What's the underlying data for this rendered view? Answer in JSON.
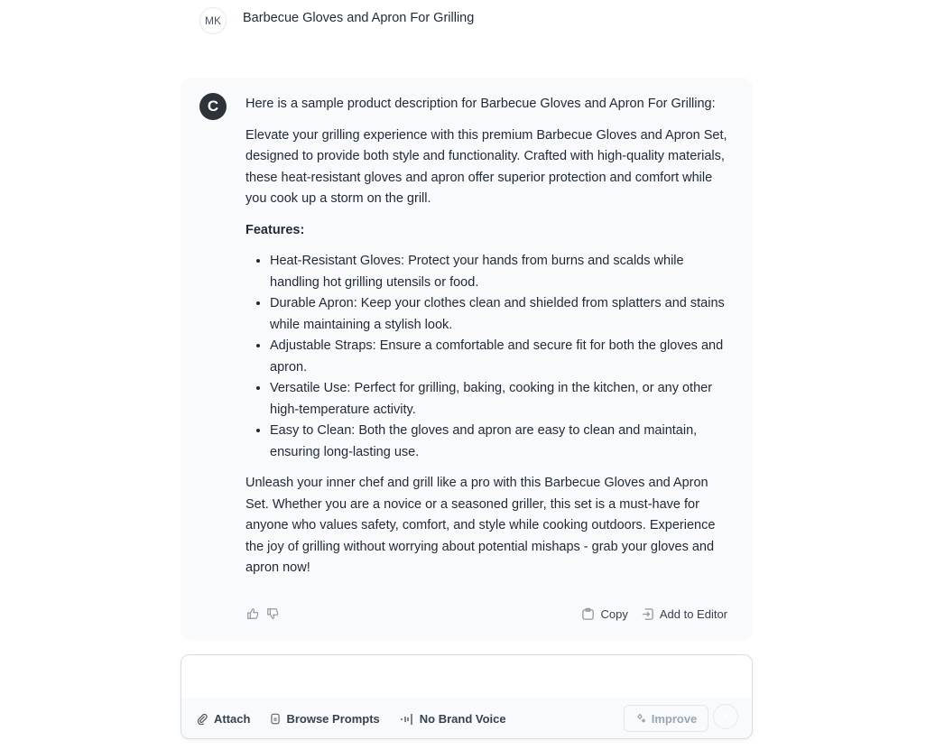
{
  "user_message": {
    "avatar_initials": "MK",
    "text": "Barbecue Gloves and Apron For Grilling"
  },
  "assistant_message": {
    "avatar_letter": "C",
    "intro": "Here is a sample product description for Barbecue Gloves and Apron For Grilling:",
    "paragraph1": "Elevate your grilling experience with this premium Barbecue Gloves and Apron Set, designed to provide both style and functionality. Crafted with high-quality materials, these heat-resistant gloves and apron offer superior protection and comfort while you cook up a storm on the grill.",
    "features_heading": "Features:",
    "features": [
      "Heat-Resistant Gloves: Protect your hands from burns and scalds while handling hot grilling utensils or food.",
      "Durable Apron: Keep your clothes clean and shielded from splatters and stains while maintaining a stylish look.",
      "Adjustable Straps: Ensure a comfortable and secure fit for both the gloves and apron.",
      "Versatile Use: Perfect for grilling, baking, cooking in the kitchen, or any other high-temperature activity.",
      "Easy to Clean: Both the gloves and apron are easy to clean and maintain, ensuring long-lasting use."
    ],
    "closing": "Unleash your inner chef and grill like a pro with this Barbecue Gloves and Apron Set. Whether you are a novice or a seasoned griller, this set is a must-have for anyone who values safety, comfort, and style while cooking outdoors. Experience the joy of grilling without worrying about potential mishaps - grab your gloves and apron now!",
    "actions": {
      "thumbs_up_icon": "thumbs-up-icon",
      "thumbs_down_icon": "thumbs-down-icon",
      "copy_label": "Copy",
      "add_to_editor_label": "Add to Editor"
    }
  },
  "composer": {
    "input_value": "",
    "placeholder": "",
    "attach_label": "Attach",
    "browse_prompts_label": "Browse Prompts",
    "brand_voice_label": "No Brand Voice",
    "improve_label": "Improve"
  },
  "colors": {
    "assistant_avatar_bg": "#2d3338",
    "response_bg": "#f8fafb",
    "text": "#1f2937",
    "muted": "#9aa7b1"
  }
}
